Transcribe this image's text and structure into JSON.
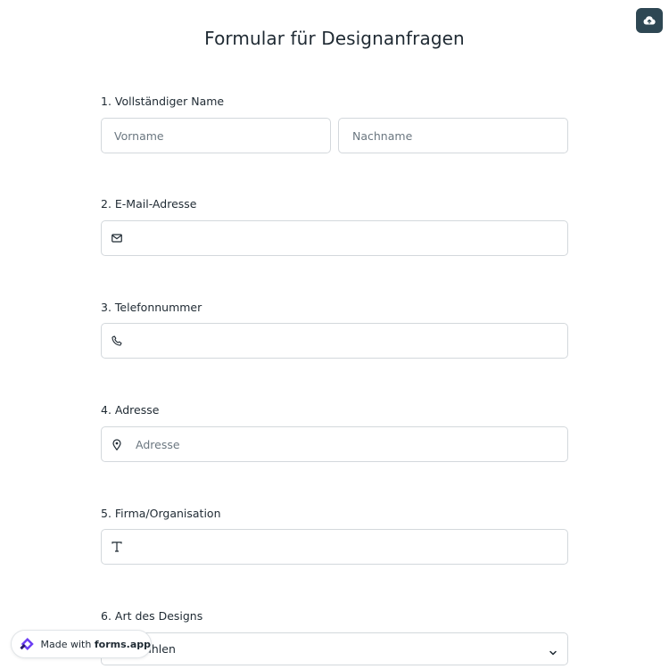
{
  "header": {
    "title": "Formular für Designanfragen",
    "upload_icon": "cloud-upload-icon"
  },
  "fields": {
    "full_name": {
      "label": "1. Vollständiger Name",
      "first_placeholder": "Vorname",
      "last_placeholder": "Nachname"
    },
    "email": {
      "label": "2. E-Mail-Adresse",
      "icon": "mail-icon"
    },
    "phone": {
      "label": "3. Telefonnummer",
      "icon": "phone-icon"
    },
    "address": {
      "label": "4. Adresse",
      "icon": "location-pin-icon",
      "placeholder": "Adresse"
    },
    "company": {
      "label": "5. Firma/Organisation",
      "icon": "text-icon"
    },
    "design_type": {
      "label": "6. Art des Designs",
      "placeholder": "Auswählen",
      "icon": "chevron-down-icon"
    }
  },
  "branding": {
    "prefix": "Made with",
    "brand": "forms.app"
  },
  "colors": {
    "upload_button_bg": "#2e4753",
    "border": "#d3d8dc",
    "text": "#1f2a33",
    "placeholder": "#6b7780",
    "logo_purple": "#6c3df4"
  }
}
